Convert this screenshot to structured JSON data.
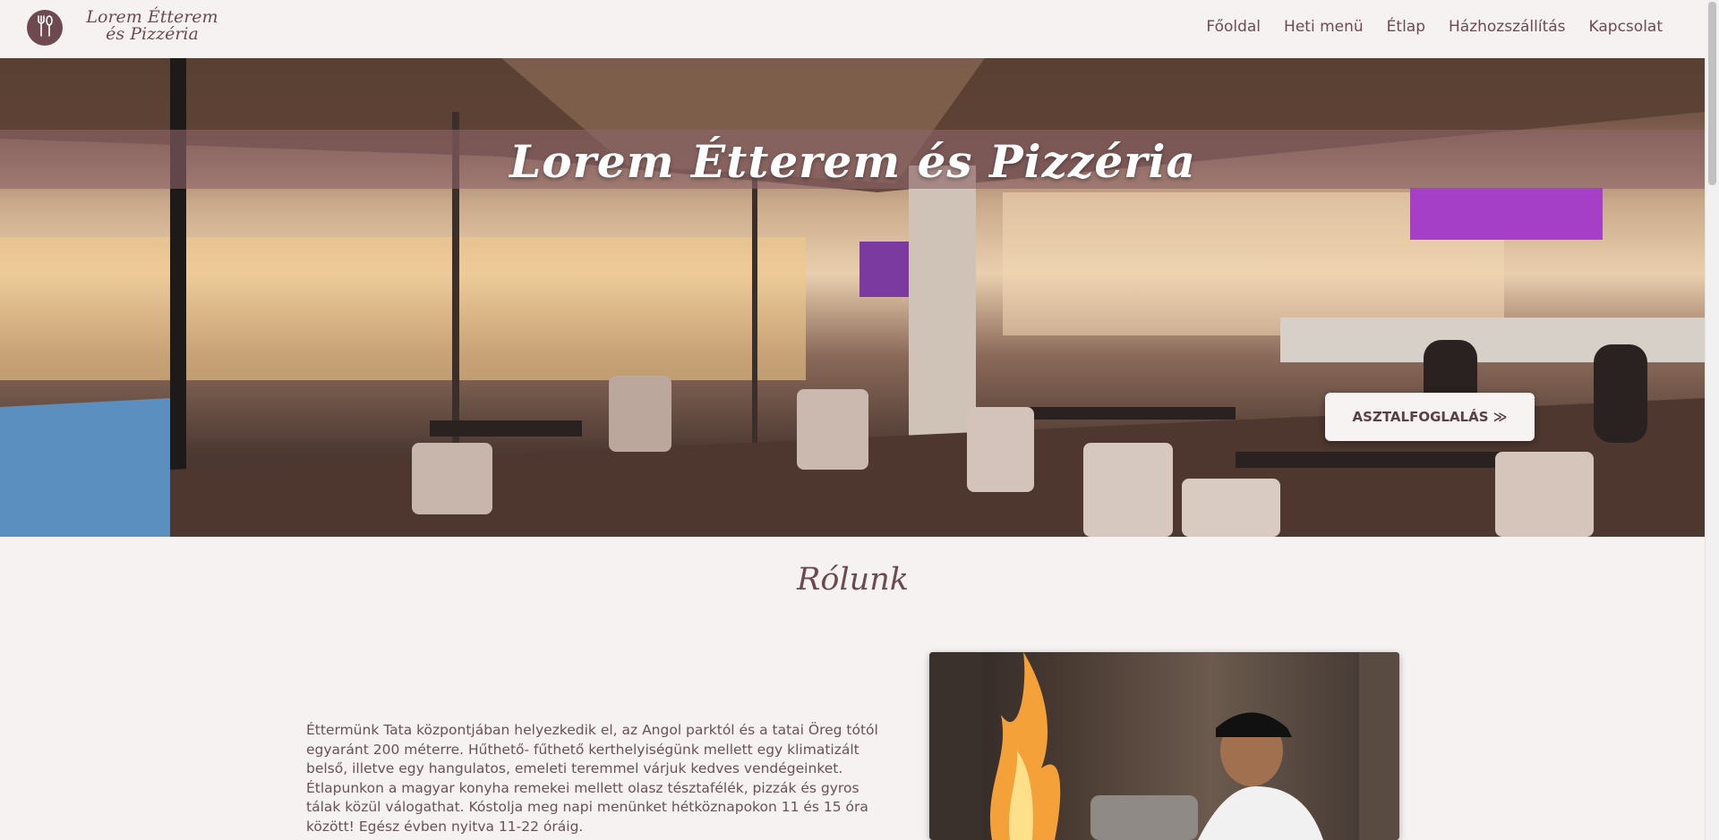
{
  "header": {
    "brand": "Lorem Étterem és Pizzéria",
    "logo_icon": "cutlery-icon",
    "nav": [
      "Főoldal",
      "Heti menü",
      "Étlap",
      "Házhozszállítás",
      "Kapcsolat"
    ]
  },
  "hero": {
    "title": "Lorem Étterem és Pizzéria",
    "button_label": "ASZTALFOGLALÁS ≫"
  },
  "about": {
    "title": "Rólunk",
    "text": "Éttermünk Tata központjában helyezkedik el, az Angol parktól és a tatai Öreg tótól egyaránt 200 méterre. Hűthető- fűthető kerthelyiségünk mellett egy klimatizált belső, illetve egy hangulatos, emeleti teremmel várjuk kedves vendégeinket. Étlapunkon a magyar konyha remekei mellett olasz tésztafélék, pizzák és gyros tálak közül válogathat. Kóstolja meg napi menünket hétköznapokon 11 és 15 óra között! Egész évben nyitva 11-22 óráig."
  },
  "colors": {
    "brand": "#6e4a50",
    "background": "#f6f2f1"
  }
}
